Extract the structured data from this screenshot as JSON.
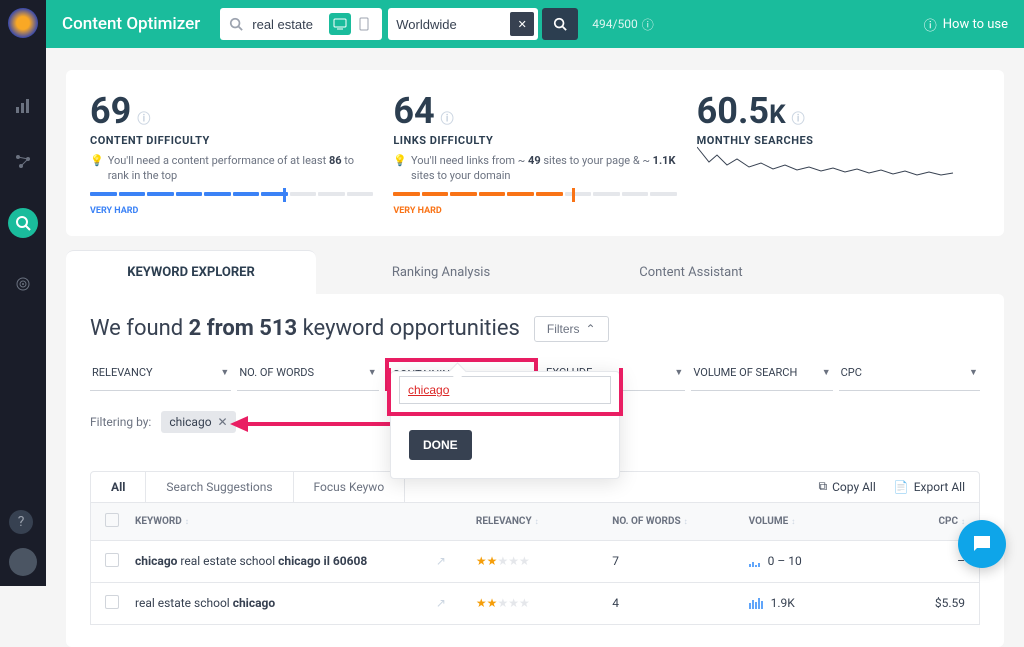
{
  "sidebar": {
    "icons": [
      "bars",
      "nodes",
      "search-active",
      "target"
    ]
  },
  "header": {
    "title": "Content Optimizer",
    "search_value": "real estate",
    "location_value": "Worldwide",
    "credits": "494/500",
    "howto": "How to use"
  },
  "metrics": {
    "content": {
      "value": "69",
      "label": "CONTENT DIFFICULTY",
      "hint_prefix": "You'll need a content performance of at least ",
      "hint_bold": "86",
      "hint_suffix": " to rank in the top",
      "level": "VERY HARD",
      "level_color": "#3b82f6"
    },
    "links": {
      "value": "64",
      "label": "LINKS DIFFICULTY",
      "hint_prefix": "You'll need links from ~ ",
      "hint_bold1": "49",
      "hint_mid": " sites to your page & ~ ",
      "hint_bold2": "1.1K",
      "hint_suffix": " sites to your domain",
      "level": "VERY HARD",
      "level_color": "#f97316"
    },
    "searches": {
      "value": "60.5",
      "unit": "K",
      "label": "MONTHLY SEARCHES"
    }
  },
  "tabs": {
    "explorer": "KEYWORD EXPLORER",
    "ranking": "Ranking Analysis",
    "assistant": "Content Assistant"
  },
  "found": {
    "prefix": "We found ",
    "bold": "2 from 513",
    "suffix": " keyword opportunities",
    "filters_btn": "Filters"
  },
  "filters": {
    "relevancy": "RELEVANCY",
    "words": "NO. OF WORDS",
    "containing": "CONTAINING",
    "exclude": "EXCLUDE",
    "volume": "VOLUME OF SEARCH",
    "cpc": "CPC"
  },
  "filtering": {
    "label": "Filtering by:",
    "chip": "chicago"
  },
  "popover": {
    "input_value": "chicago",
    "done": "DONE"
  },
  "subtabs": {
    "all": "All",
    "suggestions": "Search Suggestions",
    "focus": "Focus Keywo"
  },
  "table_actions": {
    "copy": "Copy All",
    "export": "Export All"
  },
  "columns": {
    "keyword": "KEYWORD",
    "relevancy": "RELEVANCY",
    "words": "NO. OF WORDS",
    "volume": "VOLUME",
    "cpc": "CPC"
  },
  "rows": [
    {
      "kw_b1": "chicago",
      "kw_mid": " real estate school ",
      "kw_b2": "chicago il 60608",
      "stars": 2,
      "words": "7",
      "volume": "0 – 10",
      "cpc": "–"
    },
    {
      "kw_b1": "",
      "kw_mid": "real estate school ",
      "kw_b2": "chicago",
      "stars": 2,
      "words": "4",
      "volume": "1.9K",
      "cpc": "$5.59"
    }
  ]
}
